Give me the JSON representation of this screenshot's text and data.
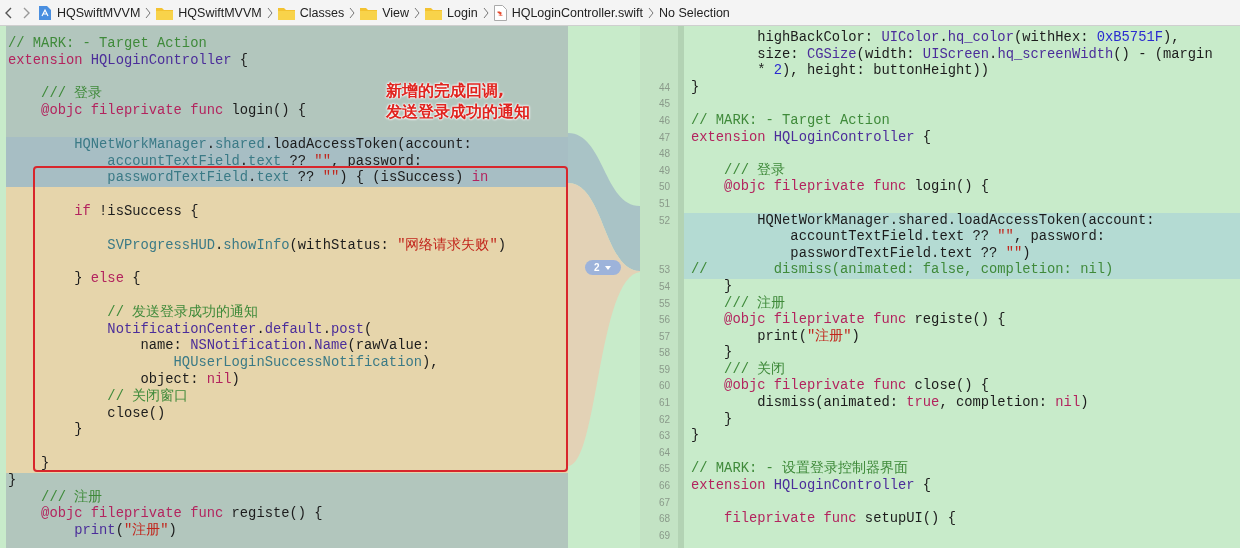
{
  "breadcrumb": {
    "items": [
      {
        "label": "HQSwiftMVVM",
        "kind": "project"
      },
      {
        "label": "HQSwiftMVVM",
        "kind": "folder"
      },
      {
        "label": "Classes",
        "kind": "folder"
      },
      {
        "label": "View",
        "kind": "folder"
      },
      {
        "label": "Login",
        "kind": "folder"
      },
      {
        "label": "HQLoginController.swift",
        "kind": "swift"
      },
      {
        "label": "No Selection",
        "kind": "plain"
      }
    ]
  },
  "comparison": {
    "left": {
      "lines": [
        {
          "kind": "context",
          "tokens": [
            {
              "text": "// MARK: - Target Action",
              "kind": "c"
            }
          ]
        },
        {
          "kind": "context",
          "tokens": [
            {
              "text": "extension ",
              "kind": "k"
            },
            {
              "text": "HQLoginController",
              "kind": "t"
            },
            {
              "text": " {",
              "kind": "p"
            }
          ]
        },
        {
          "kind": "context"
        },
        {
          "kind": "context",
          "tokens": [
            {
              "text": "    /// 登录",
              "kind": "c"
            }
          ]
        },
        {
          "kind": "context",
          "tokens": [
            {
              "text": "    @objc fileprivate func",
              "kind": "k"
            },
            {
              "text": " login() {",
              "kind": "p"
            }
          ]
        },
        {
          "kind": "context"
        },
        {
          "kind": "changed",
          "tokens": [
            {
              "text": "        HQNetWorkManager",
              "kind": "v"
            },
            {
              "text": ".",
              "kind": "p"
            },
            {
              "text": "shared",
              "kind": "v"
            },
            {
              "text": ".",
              "kind": "p"
            },
            {
              "text": "loadAccessToken",
              "kind": "p"
            },
            {
              "text": "(account:",
              "kind": "p"
            }
          ]
        },
        {
          "kind": "changed",
          "tokens": [
            {
              "text": "            accountTextField",
              "kind": "v"
            },
            {
              "text": ".",
              "kind": "p"
            },
            {
              "text": "text",
              "kind": "v"
            },
            {
              "text": " ?? ",
              "kind": "p"
            },
            {
              "text": "\"\"",
              "kind": "s"
            },
            {
              "text": ", password:",
              "kind": "p"
            }
          ]
        },
        {
          "kind": "changed",
          "tokens": [
            {
              "text": "            passwordTextField",
              "kind": "v"
            },
            {
              "text": ".",
              "kind": "p"
            },
            {
              "text": "text",
              "kind": "v"
            },
            {
              "text": " ?? ",
              "kind": "p"
            },
            {
              "text": "\"\"",
              "kind": "s"
            },
            {
              "text": ") { (isSuccess) ",
              "kind": "p"
            },
            {
              "text": "in",
              "kind": "k"
            }
          ]
        },
        {
          "kind": "added"
        },
        {
          "kind": "added",
          "tokens": [
            {
              "text": "        if",
              "kind": "k"
            },
            {
              "text": " !isSuccess {",
              "kind": "p"
            }
          ]
        },
        {
          "kind": "added"
        },
        {
          "kind": "added",
          "tokens": [
            {
              "text": "            SVProgressHUD",
              "kind": "v"
            },
            {
              "text": ".",
              "kind": "p"
            },
            {
              "text": "showInfo",
              "kind": "v"
            },
            {
              "text": "(withStatus: ",
              "kind": "p"
            },
            {
              "text": "\"网络请求失败\"",
              "kind": "s"
            },
            {
              "text": ")",
              "kind": "p"
            }
          ]
        },
        {
          "kind": "added"
        },
        {
          "kind": "added",
          "tokens": [
            {
              "text": "        } ",
              "kind": "p"
            },
            {
              "text": "else",
              "kind": "k"
            },
            {
              "text": " {",
              "kind": "p"
            }
          ]
        },
        {
          "kind": "added"
        },
        {
          "kind": "added",
          "tokens": [
            {
              "text": "            // 发送登录成功的通知",
              "kind": "c"
            }
          ]
        },
        {
          "kind": "added",
          "tokens": [
            {
              "text": "            NotificationCenter",
              "kind": "t"
            },
            {
              "text": ".",
              "kind": "p"
            },
            {
              "text": "default",
              "kind": "t"
            },
            {
              "text": ".",
              "kind": "p"
            },
            {
              "text": "post",
              "kind": "t"
            },
            {
              "text": "(",
              "kind": "p"
            }
          ]
        },
        {
          "kind": "added",
          "tokens": [
            {
              "text": "                name: ",
              "kind": "p"
            },
            {
              "text": "NSNotification",
              "kind": "t"
            },
            {
              "text": ".",
              "kind": "p"
            },
            {
              "text": "Name",
              "kind": "t"
            },
            {
              "text": "(rawValue:",
              "kind": "p"
            }
          ]
        },
        {
          "kind": "added",
          "tokens": [
            {
              "text": "                    HQUserLoginSuccessNotification",
              "kind": "v"
            },
            {
              "text": "),",
              "kind": "p"
            }
          ]
        },
        {
          "kind": "added",
          "tokens": [
            {
              "text": "                object: ",
              "kind": "p"
            },
            {
              "text": "nil",
              "kind": "k"
            },
            {
              "text": ")",
              "kind": "p"
            }
          ]
        },
        {
          "kind": "added",
          "tokens": [
            {
              "text": "            // 关闭窗口",
              "kind": "c"
            }
          ]
        },
        {
          "kind": "added",
          "tokens": [
            {
              "text": "            close()",
              "kind": "p"
            }
          ]
        },
        {
          "kind": "added",
          "tokens": [
            {
              "text": "        }",
              "kind": "p"
            }
          ]
        },
        {
          "kind": "added"
        },
        {
          "kind": "added",
          "tokens": [
            {
              "text": "    }",
              "kind": "p"
            }
          ]
        },
        {
          "kind": "context",
          "tokens": [
            {
              "text": "}",
              "kind": "p"
            }
          ]
        },
        {
          "kind": "context",
          "tokens": [
            {
              "text": "    /// 注册",
              "kind": "c"
            }
          ]
        },
        {
          "kind": "context",
          "tokens": [
            {
              "text": "    @objc fileprivate func",
              "kind": "k"
            },
            {
              "text": " registe() {",
              "kind": "p"
            }
          ]
        },
        {
          "kind": "context",
          "tokens": [
            {
              "text": "        print",
              "kind": "t"
            },
            {
              "text": "(",
              "kind": "p"
            },
            {
              "text": "\"注册\"",
              "kind": "s"
            },
            {
              "text": ")",
              "kind": "p"
            }
          ]
        }
      ]
    },
    "connector": {
      "change_count": "2"
    },
    "right": {
      "lines": [
        {
          "kind": "context",
          "tokens": [
            {
              "text": "        highBackColor: ",
              "kind": "p"
            },
            {
              "text": "UIColor",
              "kind": "t"
            },
            {
              "text": ".",
              "kind": "p"
            },
            {
              "text": "hq_color",
              "kind": "t"
            },
            {
              "text": "(withHex: ",
              "kind": "p"
            },
            {
              "text": "0xB5751F",
              "kind": "n"
            },
            {
              "text": "),",
              "kind": "p"
            }
          ]
        },
        {
          "kind": "context",
          "tokens": [
            {
              "text": "        size: ",
              "kind": "p"
            },
            {
              "text": "CGSize",
              "kind": "t"
            },
            {
              "text": "(width: ",
              "kind": "p"
            },
            {
              "text": "UIScreen",
              "kind": "t"
            },
            {
              "text": ".",
              "kind": "p"
            },
            {
              "text": "hq_screenWidth",
              "kind": "t"
            },
            {
              "text": "() - (margin",
              "kind": "p"
            }
          ]
        },
        {
          "kind": "context",
          "tokens": [
            {
              "text": "        * ",
              "kind": "p"
            },
            {
              "text": "2",
              "kind": "n"
            },
            {
              "text": "), height: buttonHeight))",
              "kind": "p"
            }
          ]
        },
        {
          "num": "44",
          "kind": "context",
          "tokens": [
            {
              "text": "}",
              "kind": "p"
            }
          ]
        },
        {
          "num": "45",
          "kind": "context"
        },
        {
          "num": "46",
          "kind": "context",
          "tokens": [
            {
              "text": "// MARK: - Target Action",
              "kind": "c"
            }
          ]
        },
        {
          "num": "47",
          "kind": "context",
          "tokens": [
            {
              "text": "extension ",
              "kind": "k"
            },
            {
              "text": "HQLoginController",
              "kind": "t"
            },
            {
              "text": " {",
              "kind": "p"
            }
          ]
        },
        {
          "num": "48",
          "kind": "context"
        },
        {
          "num": "49",
          "kind": "context",
          "tokens": [
            {
              "text": "    /// 登录",
              "kind": "c"
            }
          ]
        },
        {
          "num": "50",
          "kind": "context",
          "tokens": [
            {
              "text": "    @objc fileprivate func",
              "kind": "k"
            },
            {
              "text": " login() {",
              "kind": "p"
            }
          ]
        },
        {
          "num": "51",
          "kind": "context"
        },
        {
          "num": "52",
          "kind": "changed",
          "tokens": [
            {
              "text": "        HQNetWorkManager.shared.loadAccessToken(account:",
              "kind": "p"
            }
          ]
        },
        {
          "kind": "changed",
          "tokens": [
            {
              "text": "            accountTextField.text ?? ",
              "kind": "p"
            },
            {
              "text": "\"\"",
              "kind": "s"
            },
            {
              "text": ", password:",
              "kind": "p"
            }
          ]
        },
        {
          "kind": "changed",
          "tokens": [
            {
              "text": "            passwordTextField.text ?? ",
              "kind": "p"
            },
            {
              "text": "\"\"",
              "kind": "s"
            },
            {
              "text": ")",
              "kind": "p"
            }
          ]
        },
        {
          "num": "53",
          "kind": "changed",
          "tokens": [
            {
              "text": "//        dismiss(animated: false, completion: nil)",
              "kind": "c"
            }
          ]
        },
        {
          "num": "54",
          "kind": "context",
          "tokens": [
            {
              "text": "    }",
              "kind": "p"
            }
          ]
        },
        {
          "num": "55",
          "kind": "context",
          "tokens": [
            {
              "text": "    /// 注册",
              "kind": "c"
            }
          ]
        },
        {
          "num": "56",
          "kind": "context",
          "tokens": [
            {
              "text": "    @objc fileprivate func",
              "kind": "k"
            },
            {
              "text": " registe() {",
              "kind": "p"
            }
          ]
        },
        {
          "num": "57",
          "kind": "context",
          "tokens": [
            {
              "text": "        print(",
              "kind": "p"
            },
            {
              "text": "\"注册\"",
              "kind": "s"
            },
            {
              "text": ")",
              "kind": "p"
            }
          ]
        },
        {
          "num": "58",
          "kind": "context",
          "tokens": [
            {
              "text": "    }",
              "kind": "p"
            }
          ]
        },
        {
          "num": "59",
          "kind": "context",
          "tokens": [
            {
              "text": "    /// 关闭",
              "kind": "c"
            }
          ]
        },
        {
          "num": "60",
          "kind": "context",
          "tokens": [
            {
              "text": "    @objc fileprivate func",
              "kind": "k"
            },
            {
              "text": " close() {",
              "kind": "p"
            }
          ]
        },
        {
          "num": "61",
          "kind": "context",
          "tokens": [
            {
              "text": "        dismiss(animated: ",
              "kind": "p"
            },
            {
              "text": "true",
              "kind": "k"
            },
            {
              "text": ", completion: ",
              "kind": "p"
            },
            {
              "text": "nil",
              "kind": "k"
            },
            {
              "text": ")",
              "kind": "p"
            }
          ]
        },
        {
          "num": "62",
          "kind": "context",
          "tokens": [
            {
              "text": "    }",
              "kind": "p"
            }
          ]
        },
        {
          "num": "63",
          "kind": "context",
          "tokens": [
            {
              "text": "}",
              "kind": "p"
            }
          ]
        },
        {
          "num": "64",
          "kind": "context"
        },
        {
          "num": "65",
          "kind": "context",
          "tokens": [
            {
              "text": "// MARK: - 设置登录控制器界面",
              "kind": "c"
            }
          ]
        },
        {
          "num": "66",
          "kind": "context",
          "tokens": [
            {
              "text": "extension ",
              "kind": "k"
            },
            {
              "text": "HQLoginController",
              "kind": "t"
            },
            {
              "text": " {",
              "kind": "p"
            }
          ]
        },
        {
          "num": "67",
          "kind": "context"
        },
        {
          "num": "68",
          "kind": "context",
          "tokens": [
            {
              "text": "    fileprivate func",
              "kind": "k"
            },
            {
              "text": " setupUI() {",
              "kind": "p"
            }
          ]
        },
        {
          "num": "69",
          "kind": "context"
        }
      ]
    }
  },
  "annotation": {
    "lines": [
      "新增的完成回调,",
      "发送登录成功的通知"
    ]
  }
}
